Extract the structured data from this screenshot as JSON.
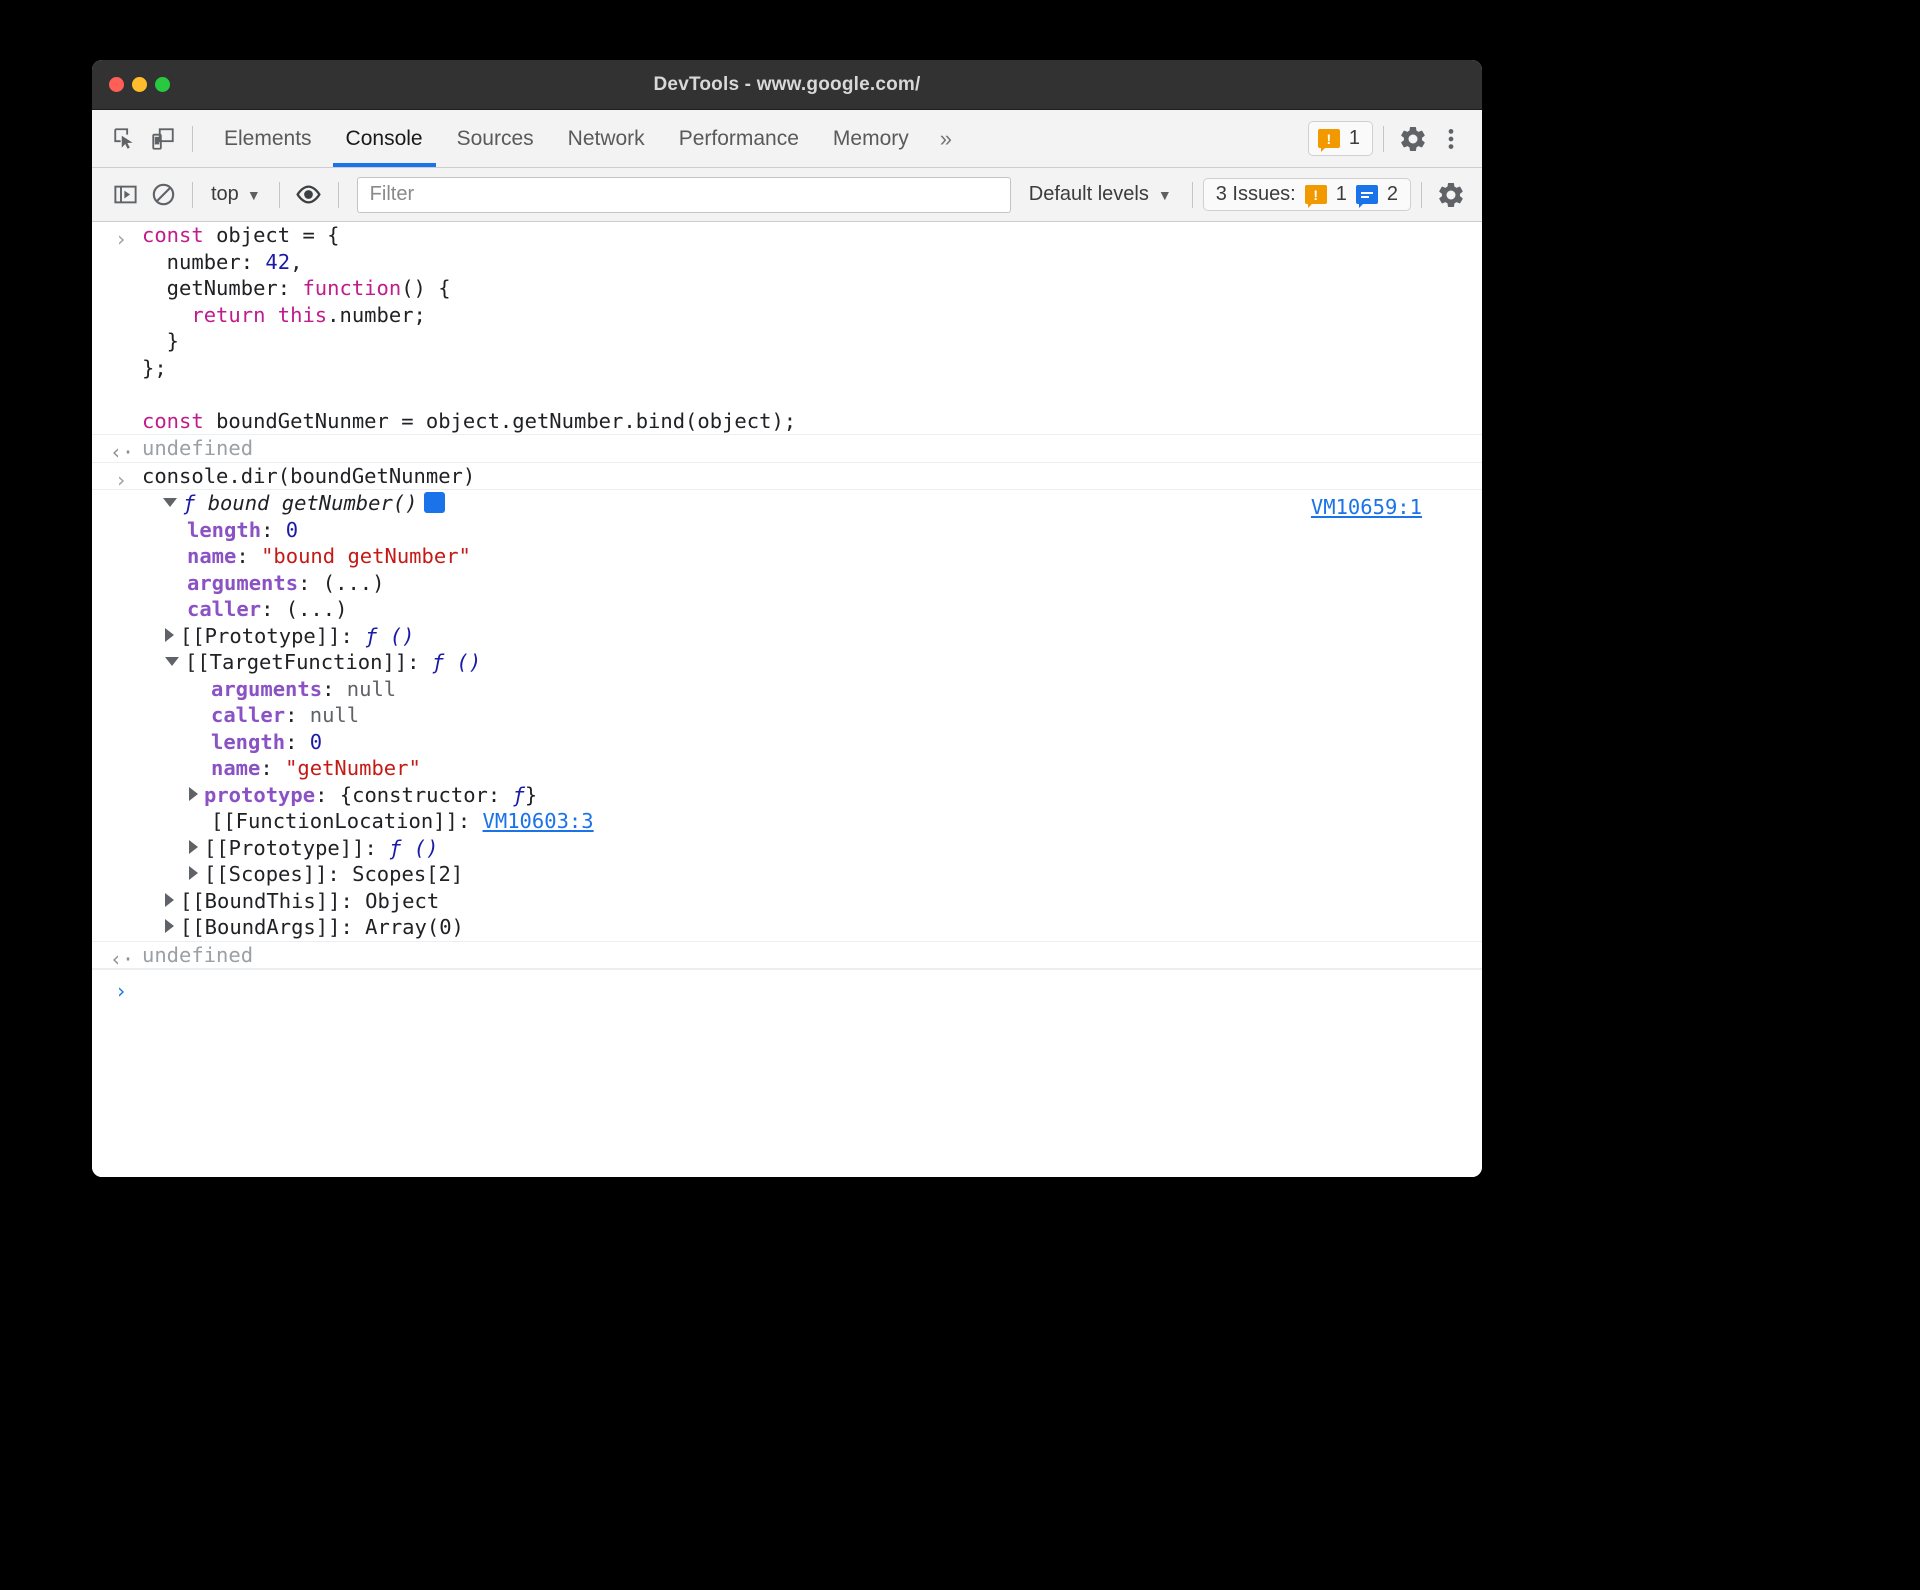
{
  "window": {
    "title": "DevTools - www.google.com/",
    "traffic_lights": [
      "close",
      "minimize",
      "zoom"
    ]
  },
  "tabbar": {
    "inspect_icon": "inspect-element-icon",
    "device_icon": "device-toolbar-icon",
    "tabs": [
      {
        "label": "Elements",
        "active": false
      },
      {
        "label": "Console",
        "active": true
      },
      {
        "label": "Sources",
        "active": false
      },
      {
        "label": "Network",
        "active": false
      },
      {
        "label": "Performance",
        "active": false
      },
      {
        "label": "Memory",
        "active": false
      }
    ],
    "more_tabs": "»",
    "warning_count": "1",
    "settings_icon": "gear-icon",
    "more_icon": "kebab-menu-icon"
  },
  "console_toolbar": {
    "sidebar_toggle_icon": "console-sidebar-icon",
    "clear_icon": "clear-console-icon",
    "context": "top",
    "context_caret": "▼",
    "eye_icon": "live-expression-eye-icon",
    "filter_placeholder": "Filter",
    "filter_value": "",
    "levels": "Default levels",
    "levels_caret": "▼",
    "issues_label": "3 Issues:",
    "issues_warning_count": "1",
    "issues_info_count": "2",
    "settings_icon": "console-settings-gear-icon"
  },
  "console": {
    "input_marker": "›",
    "output_marker": "‹·",
    "entries": [
      {
        "type": "input",
        "lines": [
          [
            {
              "t": "const ",
              "c": "kw"
            },
            {
              "t": "object = {",
              "c": "plain"
            }
          ],
          [
            {
              "t": "  number: ",
              "c": "plain"
            },
            {
              "t": "42",
              "c": "num"
            },
            {
              "t": ",",
              "c": "plain"
            }
          ],
          [
            {
              "t": "  getNumber: ",
              "c": "plain"
            },
            {
              "t": "function",
              "c": "kw"
            },
            {
              "t": "() {",
              "c": "plain"
            }
          ],
          [
            {
              "t": "    ",
              "c": "plain"
            },
            {
              "t": "return this",
              "c": "kw"
            },
            {
              "t": ".number;",
              "c": "plain"
            }
          ],
          [
            {
              "t": "  }",
              "c": "plain"
            }
          ],
          [
            {
              "t": "};",
              "c": "plain"
            }
          ],
          [
            {
              "t": " ",
              "c": "plain"
            }
          ],
          [
            {
              "t": "const ",
              "c": "kw"
            },
            {
              "t": "boundGetNunmer = object.getNumber.bind(object);",
              "c": "plain"
            }
          ]
        ]
      },
      {
        "type": "output",
        "lines": [
          [
            {
              "t": "undefined",
              "c": "gray"
            }
          ]
        ]
      },
      {
        "type": "input",
        "lines": [
          [
            {
              "t": "console.dir(boundGetNunmer)",
              "c": "plain"
            }
          ]
        ]
      }
    ],
    "dir_result": {
      "source_link": "VM10659:1",
      "header": {
        "triangle": "down",
        "fn_symbol": "ƒ",
        "fn_name": "bound getNumber()",
        "info_chip": "i"
      },
      "tree": [
        {
          "indent": 1,
          "tri": "none",
          "parts": [
            {
              "t": "length",
              "c": "prop"
            },
            {
              "t": ": ",
              "c": "plain"
            },
            {
              "t": "0",
              "c": "num"
            }
          ]
        },
        {
          "indent": 1,
          "tri": "none",
          "parts": [
            {
              "t": "name",
              "c": "prop"
            },
            {
              "t": ": ",
              "c": "plain"
            },
            {
              "t": "\"bound getNumber\"",
              "c": "str"
            }
          ]
        },
        {
          "indent": 1,
          "tri": "none",
          "parts": [
            {
              "t": "arguments",
              "c": "prop"
            },
            {
              "t": ": (...)",
              "c": "plain"
            }
          ]
        },
        {
          "indent": 1,
          "tri": "none",
          "parts": [
            {
              "t": "caller",
              "c": "prop"
            },
            {
              "t": ": (...)",
              "c": "plain"
            }
          ]
        },
        {
          "indent": 1,
          "tri": "right",
          "parts": [
            {
              "t": "[[Prototype]]: ",
              "c": "plain"
            },
            {
              "t": "ƒ ()",
              "c": "fsym"
            }
          ]
        },
        {
          "indent": 1,
          "tri": "down",
          "parts": [
            {
              "t": "[[TargetFunction]]: ",
              "c": "plain"
            },
            {
              "t": "ƒ ()",
              "c": "fsym"
            }
          ]
        },
        {
          "indent": 2,
          "tri": "none",
          "parts": [
            {
              "t": "arguments",
              "c": "prop"
            },
            {
              "t": ": ",
              "c": "plain"
            },
            {
              "t": "null",
              "c": "nullv"
            }
          ]
        },
        {
          "indent": 2,
          "tri": "none",
          "parts": [
            {
              "t": "caller",
              "c": "prop"
            },
            {
              "t": ": ",
              "c": "plain"
            },
            {
              "t": "null",
              "c": "nullv"
            }
          ]
        },
        {
          "indent": 2,
          "tri": "none",
          "parts": [
            {
              "t": "length",
              "c": "prop"
            },
            {
              "t": ": ",
              "c": "plain"
            },
            {
              "t": "0",
              "c": "num"
            }
          ]
        },
        {
          "indent": 2,
          "tri": "none",
          "parts": [
            {
              "t": "name",
              "c": "prop"
            },
            {
              "t": ": ",
              "c": "plain"
            },
            {
              "t": "\"getNumber\"",
              "c": "str"
            }
          ]
        },
        {
          "indent": 2,
          "tri": "right",
          "parts": [
            {
              "t": "prototype",
              "c": "prop"
            },
            {
              "t": ": {constructor: ",
              "c": "plain"
            },
            {
              "t": "ƒ",
              "c": "fsym"
            },
            {
              "t": "}",
              "c": "plain"
            }
          ]
        },
        {
          "indent": 2,
          "tri": "none",
          "parts": [
            {
              "t": "[[FunctionLocation]]: ",
              "c": "plain"
            },
            {
              "t": "VM10603:3",
              "c": "link"
            }
          ]
        },
        {
          "indent": 2,
          "tri": "right",
          "parts": [
            {
              "t": "[[Prototype]]: ",
              "c": "plain"
            },
            {
              "t": "ƒ ()",
              "c": "fsym"
            }
          ]
        },
        {
          "indent": 2,
          "tri": "right",
          "parts": [
            {
              "t": "[[Scopes]]: ",
              "c": "plain"
            },
            {
              "t": "Scopes[2]",
              "c": "plain"
            }
          ]
        },
        {
          "indent": 1,
          "tri": "right",
          "parts": [
            {
              "t": "[[BoundThis]]: ",
              "c": "plain"
            },
            {
              "t": "Object",
              "c": "plain"
            }
          ]
        },
        {
          "indent": 1,
          "tri": "right",
          "parts": [
            {
              "t": "[[BoundArgs]]: ",
              "c": "plain"
            },
            {
              "t": "Array(0)",
              "c": "plain"
            }
          ]
        }
      ]
    },
    "final_output": "undefined",
    "prompt_marker": "›"
  },
  "colors": {
    "accent": "#1a73e8",
    "warning": "#f29900",
    "keyword": "#c01c8b",
    "string": "#c41a16",
    "number": "#1a1aa6",
    "property": "#8a52c4",
    "titlebar": "#323232"
  }
}
